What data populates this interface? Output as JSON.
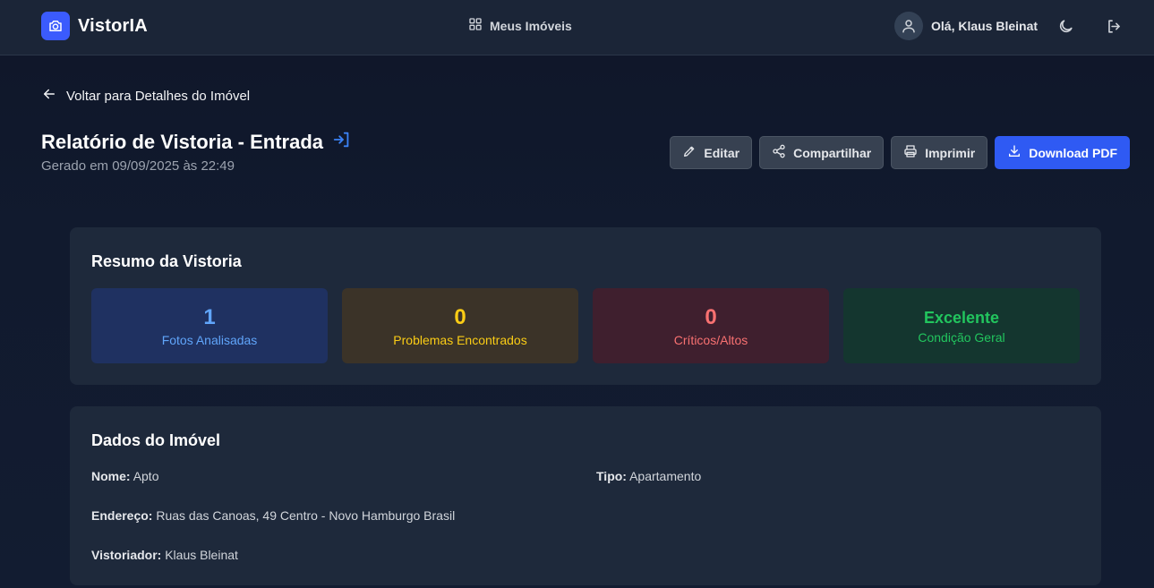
{
  "header": {
    "brand": "VistorIA",
    "nav_label": "Meus Imóveis",
    "greeting": "Olá, Klaus Bleinat"
  },
  "back_link": "Voltar para Detalhes do Imóvel",
  "report": {
    "title": "Relatório de Vistoria - Entrada",
    "generated": "Gerado em 09/09/2025 às 22:49"
  },
  "actions": {
    "edit": "Editar",
    "share": "Compartilhar",
    "print": "Imprimir",
    "download": "Download PDF"
  },
  "summary": {
    "title": "Resumo da Vistoria",
    "stats": [
      {
        "value": "1",
        "label": "Fotos Analisadas",
        "color": "#60a5fa"
      },
      {
        "value": "0",
        "label": "Problemas Encontrados",
        "color": "#facc15"
      },
      {
        "value": "0",
        "label": "Críticos/Altos",
        "color": "#f87171"
      },
      {
        "value": "Excelente",
        "label": "Condição Geral",
        "color": "#22c55e"
      }
    ]
  },
  "property": {
    "title": "Dados do Imóvel",
    "name_label": "Nome:",
    "name": "Apto",
    "type_label": "Tipo:",
    "type": "Apartamento",
    "address_label": "Endereço:",
    "address": "Ruas das Canoas, 49 Centro - Novo Hamburgo Brasil",
    "inspector_label": "Vistoriador:",
    "inspector": "Klaus Bleinat"
  },
  "colors": {
    "accent": "#2f5af3",
    "header_bg": "#1b2537",
    "card_bg": "#1e293b"
  }
}
